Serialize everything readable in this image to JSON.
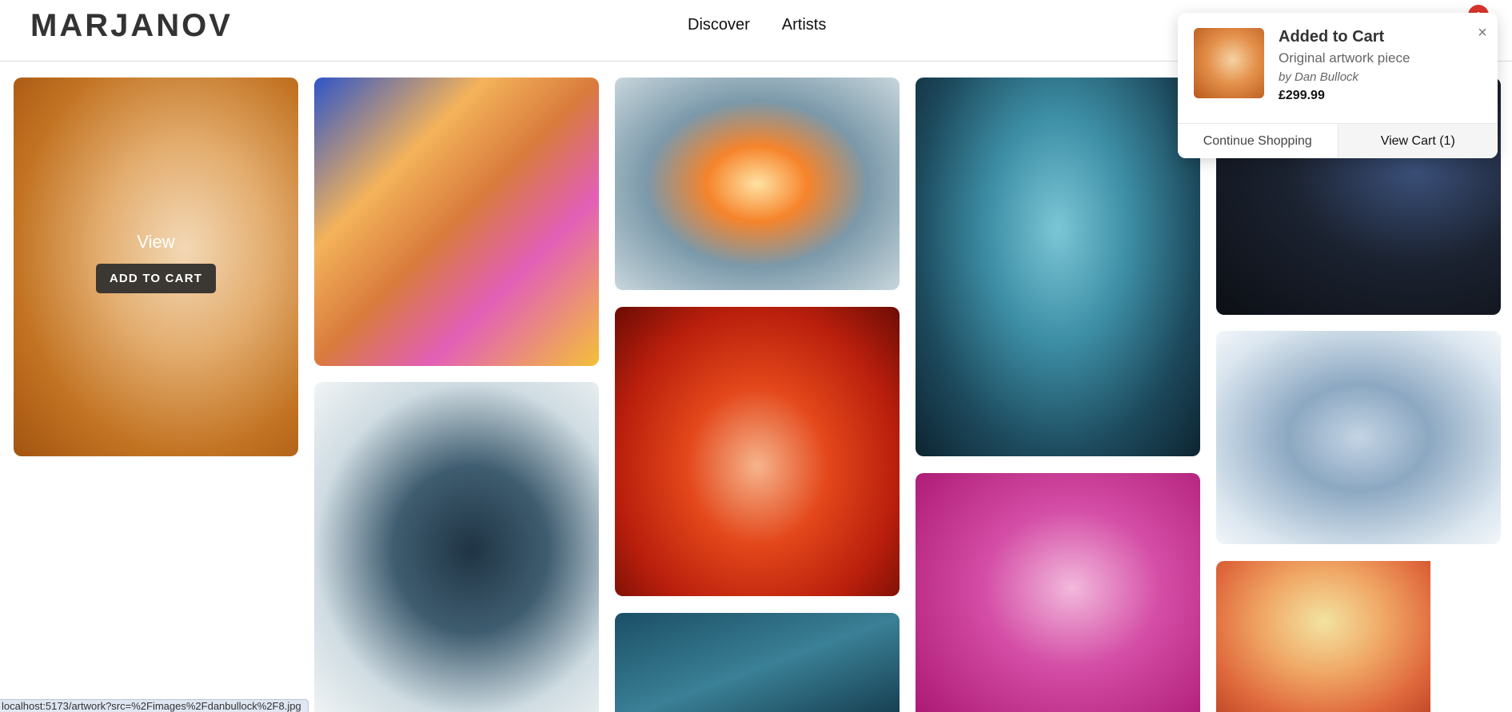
{
  "header": {
    "logo": "MARJANOV",
    "nav": [
      {
        "label": "Discover"
      },
      {
        "label": "Artists"
      }
    ],
    "cart_count": "1"
  },
  "gallery": {
    "hover_overlay": {
      "view_label": "View",
      "add_to_cart_label": "ADD TO CART"
    }
  },
  "toast": {
    "title": "Added to Cart",
    "description": "Original artwork piece",
    "artist": "by Dan Bullock",
    "price": "£299.99",
    "close_symbol": "×",
    "continue_label": "Continue Shopping",
    "view_cart_label": "View Cart (1)"
  },
  "status_bar": {
    "url": "localhost:5173/artwork?src=%2Fimages%2Fdanbullock%2F8.jpg"
  }
}
